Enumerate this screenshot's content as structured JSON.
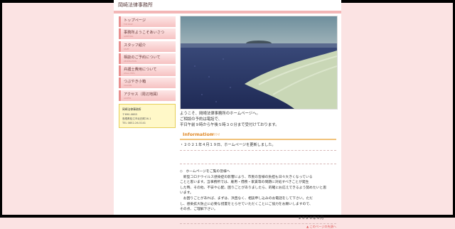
{
  "site": {
    "title": "岡崎法律事務所"
  },
  "nav": [
    {
      "label": "トップページ",
      "sub": "TOP PAGE"
    },
    {
      "label": "事務所ようこそあいさつ",
      "sub": "GREETING"
    },
    {
      "label": "スタッフ紹介",
      "sub": "STAFF"
    },
    {
      "label": "相談のご予約について",
      "sub": "RESERVATION"
    },
    {
      "label": "弁護士費用について",
      "sub": "LEGAL FEES"
    },
    {
      "label": "つぶやき小箱",
      "sub": "COLUMN"
    },
    {
      "label": "アクセス（周辺地図）",
      "sub": "ACCESS"
    }
  ],
  "office": {
    "name": "岡崎法律事務所",
    "zip": "〒690-0883",
    "address": "島根県松江市北田町26-1",
    "tel": "TEL 0852-26-5141"
  },
  "intro": [
    "ようこそ、岡崎法律事務所のホームページへ。",
    "ご相談の予約は電話で、",
    "平日午前９時から午後５時３０分まで受付けております。"
  ],
  "information": {
    "heading": "Information",
    "sub": "お知らせ"
  },
  "news": [
    "・２０２１年４月１９日、ホームページを更新しました。"
  ],
  "notice": [
    "◇　ホームページをご覧の皆様へ",
    "　新型コロナウイルス感染症の影響により、市民の皆様の負担も日々大きくなっている",
    "ことと思います。当事務所では、雇用・借務・家賃等の問題に対処すべきことが発生",
    "した時、その他、不安や心配、困りごとがありましたら、的確にお応えできるよう努めたいと思",
    "います。",
    "　お困りごとがあれば、まずは、浜直なく、相談申し込みのお電話をして下さい。ただ",
    "し、感染拡大防止に必要な措置をとらせていただくことにご協力をお願いしますので、",
    "その点、ご理解下さい。"
  ],
  "date": "２０２０年６月",
  "pagetop": "▲ このページの先頭へ",
  "colors": {
    "accent": "#f3b6b6",
    "info": "#e08a2a",
    "background": "#fbe3e3"
  }
}
